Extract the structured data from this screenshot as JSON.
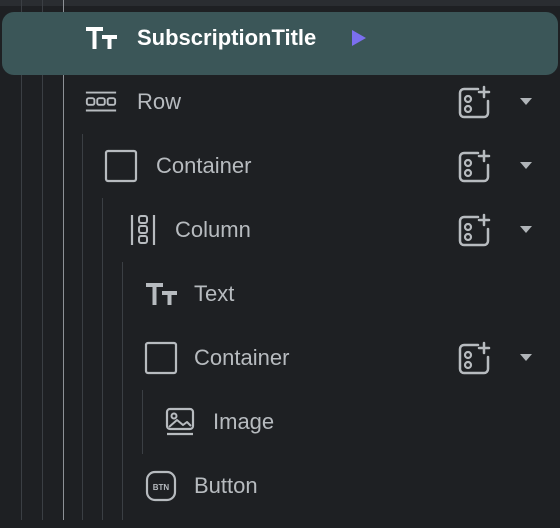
{
  "colors": {
    "background": "#1e2023",
    "selected_background": "#3b5658",
    "text": "#b7bbbf",
    "selected_text": "#ffffff",
    "icon": "#b7bbbf",
    "play_accent": "#7b6ff0"
  },
  "tree": {
    "nodes": [
      {
        "label": "SubscriptionTitle",
        "icon": "text-icon",
        "selected": true
      },
      {
        "label": "Row",
        "icon": "row-icon"
      },
      {
        "label": "Container",
        "icon": "container-icon"
      },
      {
        "label": "Column",
        "icon": "column-icon"
      },
      {
        "label": "Text",
        "icon": "text-icon"
      },
      {
        "label": "Container",
        "icon": "container-icon"
      },
      {
        "label": "Image",
        "icon": "image-icon"
      },
      {
        "label": "Button",
        "icon": "button-icon"
      }
    ]
  },
  "icons": {
    "add_child": "add-widget-icon",
    "expand": "chevron-down-icon",
    "run": "play-icon"
  }
}
